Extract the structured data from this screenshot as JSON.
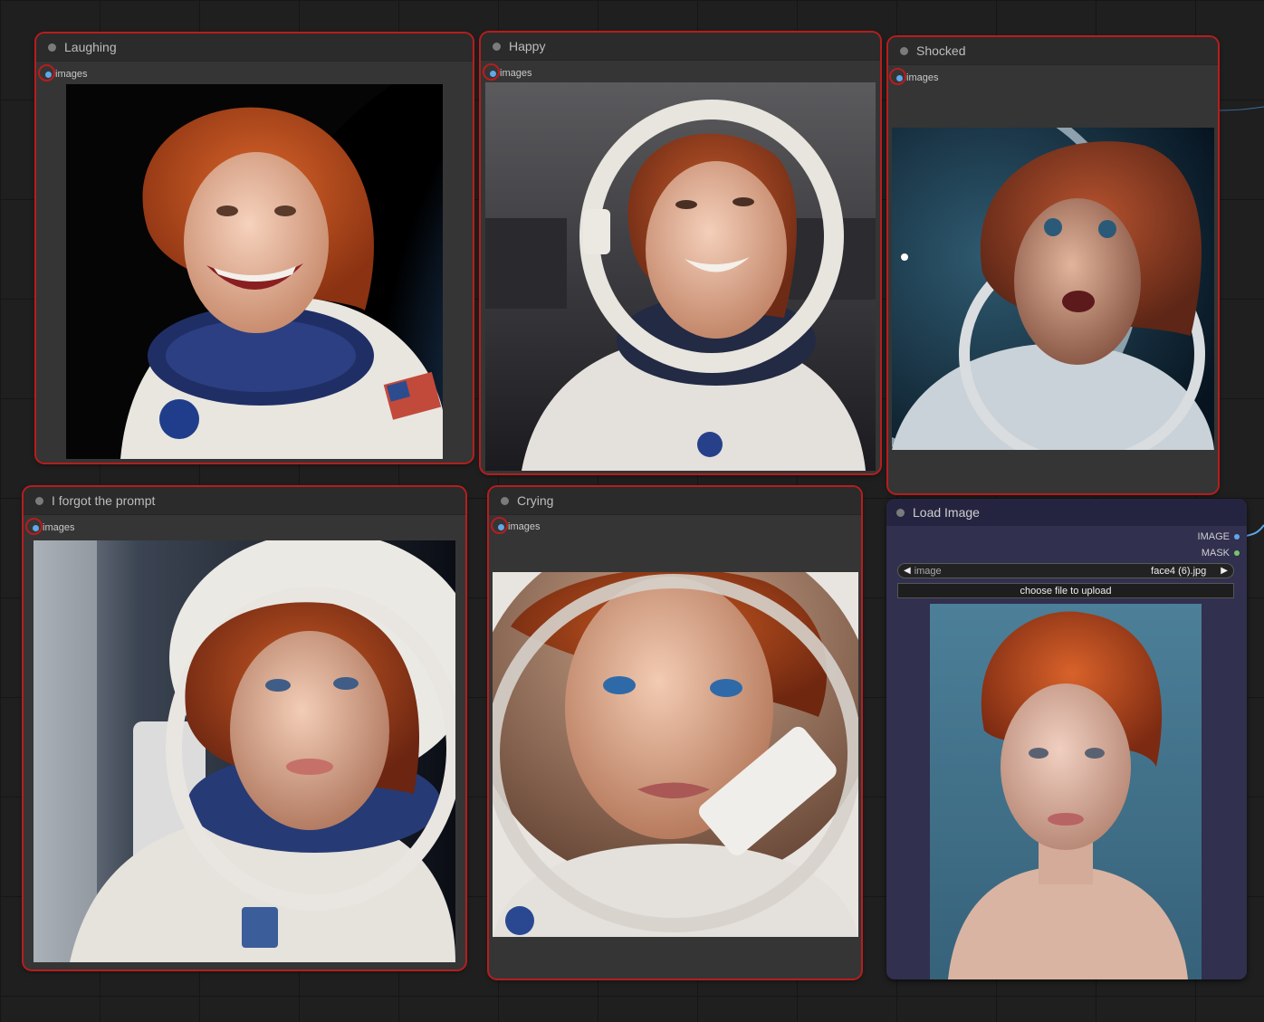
{
  "nodes": [
    {
      "title": "Laughing",
      "input": "images"
    },
    {
      "title": "Happy",
      "input": "images"
    },
    {
      "title": "Shocked",
      "input": "images"
    },
    {
      "title": "I forgot the prompt",
      "input": "images"
    },
    {
      "title": "Crying",
      "input": "images"
    }
  ],
  "load_image": {
    "title": "Load Image",
    "outputs": [
      "IMAGE",
      "MASK"
    ],
    "combo_label": "image",
    "combo_value": "face4 (6).jpg",
    "upload_label": "choose file to upload"
  },
  "colors": {
    "selected_outline": "#b81d1d",
    "image_port": "#5fa8ea",
    "mask_port": "#7ac36a",
    "node_bg": "#353535",
    "load_node_bg": "#31304f"
  }
}
